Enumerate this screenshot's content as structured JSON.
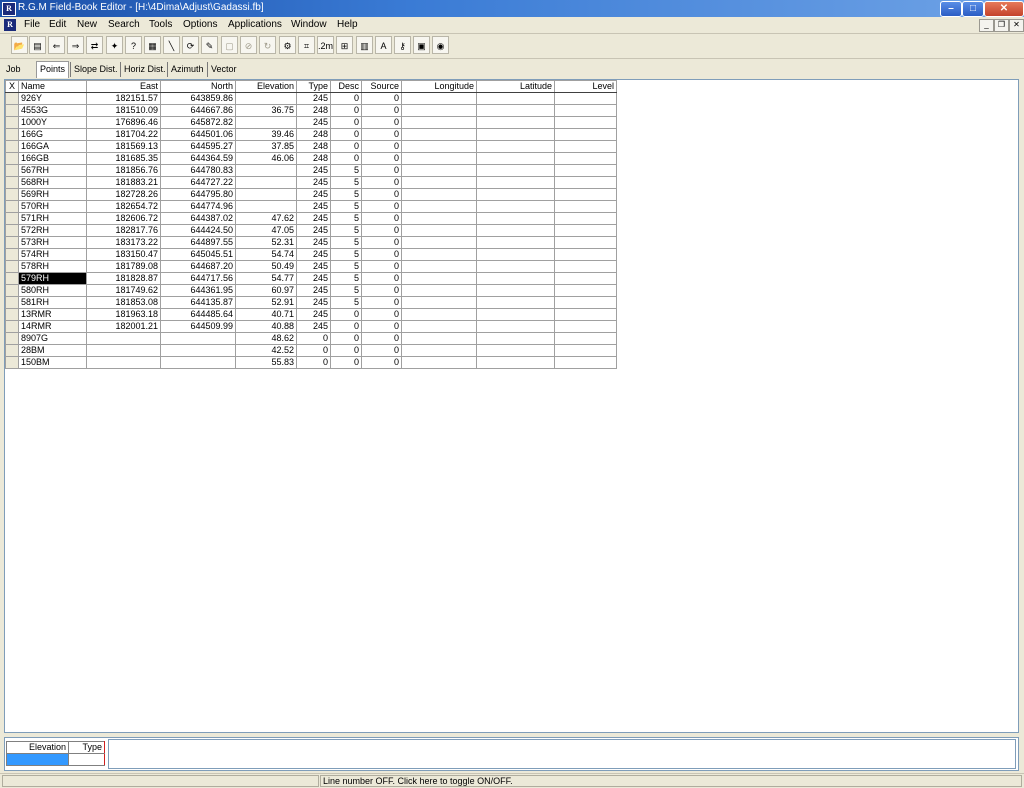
{
  "window": {
    "title": "R.G.M Field-Book Editor - [H:\\4Dima\\Adjust\\Gadassi.fb]",
    "app_icon_text": "R",
    "controls": {
      "minimize": "–",
      "maximize": "□",
      "close": "✕"
    }
  },
  "menu": {
    "doc_icon_text": "R",
    "items": [
      "File",
      "Edit",
      "New",
      "Search",
      "Tools",
      "Options",
      "Applications",
      "Window",
      "Help"
    ],
    "mdi_controls": {
      "minimize": "_",
      "restore": "❐",
      "close": "✕"
    }
  },
  "toolbar": {
    "buttons": [
      {
        "name": "open-icon",
        "glyph": "📂"
      },
      {
        "name": "document-icon",
        "glyph": "▤"
      },
      {
        "name": "import-icon",
        "glyph": "⇐"
      },
      {
        "name": "export-icon",
        "glyph": "⇒"
      },
      {
        "name": "convert-icon",
        "glyph": "⇄"
      },
      {
        "name": "walk-icon",
        "glyph": "✦"
      },
      {
        "name": "find-icon",
        "glyph": "?"
      },
      {
        "name": "report-icon",
        "glyph": "▦"
      },
      {
        "name": "line-icon",
        "glyph": "╲"
      },
      {
        "name": "transform-icon",
        "glyph": "⟳"
      },
      {
        "name": "adjust-icon",
        "glyph": "✎"
      },
      {
        "name": "disabled-a-icon",
        "glyph": "▢",
        "disabled": true
      },
      {
        "name": "disabled-b-icon",
        "glyph": "⊘",
        "disabled": true
      },
      {
        "name": "disabled-c-icon",
        "glyph": "↻",
        "disabled": true
      },
      {
        "name": "settings-icon",
        "glyph": "⚙"
      },
      {
        "name": "calc-icon",
        "glyph": "⌗"
      },
      {
        "name": "scale-icon",
        "glyph": ".2m"
      },
      {
        "name": "network-icon",
        "glyph": "⊞"
      },
      {
        "name": "table-icon",
        "glyph": "▥"
      },
      {
        "name": "font-icon",
        "glyph": "A"
      },
      {
        "name": "key-icon",
        "glyph": "⚷"
      },
      {
        "name": "calculator-icon",
        "glyph": "▣"
      },
      {
        "name": "globe-icon",
        "glyph": "◉"
      }
    ]
  },
  "tabs": [
    {
      "label": "Job"
    },
    {
      "label": "Points",
      "active": true
    },
    {
      "label": "Slope Dist."
    },
    {
      "label": "Horiz Dist."
    },
    {
      "label": "Azimuth"
    },
    {
      "label": "Vector"
    }
  ],
  "grid": {
    "corner": "X",
    "columns": [
      "Name",
      "East",
      "North",
      "Elevation",
      "Type",
      "Desc",
      "Source",
      "Longitude",
      "Latitude",
      "Level"
    ],
    "rows": [
      [
        "926Y",
        "182151.57",
        "643859.86",
        "",
        "245",
        "0",
        "0",
        "",
        "",
        ""
      ],
      [
        "4553G",
        "181510.09",
        "644667.86",
        "36.75",
        "248",
        "0",
        "0",
        "",
        "",
        ""
      ],
      [
        "1000Y",
        "176896.46",
        "645872.82",
        "",
        "245",
        "0",
        "0",
        "",
        "",
        ""
      ],
      [
        "166G",
        "181704.22",
        "644501.06",
        "39.46",
        "248",
        "0",
        "0",
        "",
        "",
        ""
      ],
      [
        "166GA",
        "181569.13",
        "644595.27",
        "37.85",
        "248",
        "0",
        "0",
        "",
        "",
        ""
      ],
      [
        "166GB",
        "181685.35",
        "644364.59",
        "46.06",
        "248",
        "0",
        "0",
        "",
        "",
        ""
      ],
      [
        "567RH",
        "181856.76",
        "644780.83",
        "",
        "245",
        "5",
        "0",
        "",
        "",
        ""
      ],
      [
        "568RH",
        "181883.21",
        "644727.22",
        "",
        "245",
        "5",
        "0",
        "",
        "",
        ""
      ],
      [
        "569RH",
        "182728.26",
        "644795.80",
        "",
        "245",
        "5",
        "0",
        "",
        "",
        ""
      ],
      [
        "570RH",
        "182654.72",
        "644774.96",
        "",
        "245",
        "5",
        "0",
        "",
        "",
        ""
      ],
      [
        "571RH",
        "182606.72",
        "644387.02",
        "47.62",
        "245",
        "5",
        "0",
        "",
        "",
        ""
      ],
      [
        "572RH",
        "182817.76",
        "644424.50",
        "47.05",
        "245",
        "5",
        "0",
        "",
        "",
        ""
      ],
      [
        "573RH",
        "183173.22",
        "644897.55",
        "52.31",
        "245",
        "5",
        "0",
        "",
        "",
        ""
      ],
      [
        "574RH",
        "183150.47",
        "645045.51",
        "54.74",
        "245",
        "5",
        "0",
        "",
        "",
        ""
      ],
      [
        "578RH",
        "181789.08",
        "644687.20",
        "50.49",
        "245",
        "5",
        "0",
        "",
        "",
        ""
      ],
      [
        "579RH",
        "181828.87",
        "644717.56",
        "54.77",
        "245",
        "5",
        "0",
        "",
        "",
        ""
      ],
      [
        "580RH",
        "181749.62",
        "644361.95",
        "60.97",
        "245",
        "5",
        "0",
        "",
        "",
        ""
      ],
      [
        "581RH",
        "181853.08",
        "644135.87",
        "52.91",
        "245",
        "5",
        "0",
        "",
        "",
        ""
      ],
      [
        "13RMR",
        "181963.18",
        "644485.64",
        "40.71",
        "245",
        "0",
        "0",
        "",
        "",
        ""
      ],
      [
        "14RMR",
        "182001.21",
        "644509.99",
        "40.88",
        "245",
        "0",
        "0",
        "",
        "",
        ""
      ],
      [
        "8907G",
        "",
        "",
        "48.62",
        "0",
        "0",
        "0",
        "",
        "",
        ""
      ],
      [
        "28BM",
        "",
        "",
        "42.52",
        "0",
        "0",
        "0",
        "",
        "",
        ""
      ],
      [
        "150BM",
        "",
        "",
        "55.83",
        "0",
        "0",
        "0",
        "",
        "",
        ""
      ]
    ],
    "selected_row": 15
  },
  "bottom_panel": {
    "headers": [
      "Elevation",
      "Type"
    ]
  },
  "status": {
    "message": "Line number OFF. Click here to toggle ON/OFF."
  }
}
